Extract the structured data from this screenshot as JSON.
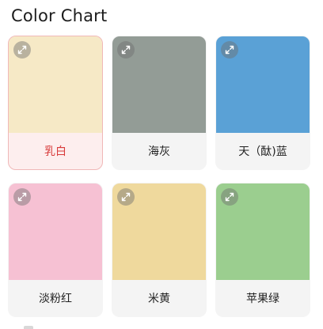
{
  "page": {
    "title": "Color Chart"
  },
  "colors": {
    "selected_border": "#f0b8b8",
    "selected_label": "#d83a3a",
    "label_bg": "#f4f4f4"
  },
  "swatches": [
    {
      "label": "乳白",
      "color": "#f6e9c6",
      "selected": true,
      "icon": "expand-icon"
    },
    {
      "label": "海灰",
      "color": "#939c96",
      "selected": false,
      "icon": "expand-icon"
    },
    {
      "label": "天（酞)蓝",
      "color": "#5aa1d6",
      "selected": false,
      "icon": "expand-icon"
    },
    {
      "label": "淡粉红",
      "color": "#f6c1d3",
      "selected": false,
      "icon": "expand-icon"
    },
    {
      "label": "米黄",
      "color": "#efd99d",
      "selected": false,
      "icon": "expand-icon"
    },
    {
      "label": "苹果绿",
      "color": "#9bce8f",
      "selected": false,
      "icon": "expand-icon"
    }
  ]
}
